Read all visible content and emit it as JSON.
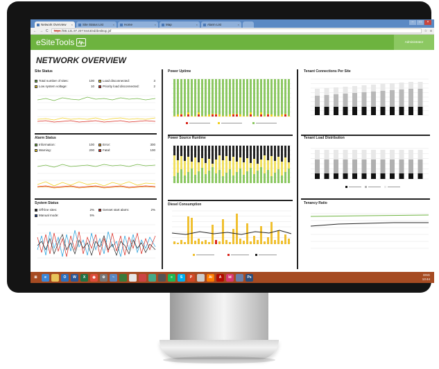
{
  "browser": {
    "tabs": [
      {
        "label": "Network Overview"
      },
      {
        "label": "Site Status List"
      },
      {
        "label": "Home"
      },
      {
        "label": "Map"
      },
      {
        "label": "Alarm List"
      }
    ],
    "url_scheme": "https",
    "url": "://88.131.97.207:8443/ed/desktop.jsf"
  },
  "app": {
    "logo": "eSiteTools",
    "user": "Administrator",
    "page_title": "NETWORK OVERVIEW"
  },
  "site_status": {
    "title": "Site Status",
    "stats": [
      {
        "label": "Total number of sites:",
        "value": "100",
        "color": "#6db33f"
      },
      {
        "label": "Load disconnected:",
        "value": "3",
        "color": "#f0d020"
      },
      {
        "label": "Low system voltage:",
        "value": "10",
        "color": "#f0d020"
      },
      {
        "label": "Priority load disconnected:",
        "value": "2",
        "color": "#d9261c"
      }
    ]
  },
  "alarm_status": {
    "title": "Alarm Status",
    "stats": [
      {
        "label": "Information:",
        "value": "100",
        "color": "#6db33f"
      },
      {
        "label": "Error:",
        "value": "300",
        "color": "#f0a020"
      },
      {
        "label": "Warning:",
        "value": "200",
        "color": "#f0d020"
      },
      {
        "label": "Fatal:",
        "value": "100",
        "color": "#d9261c"
      }
    ]
  },
  "system_status": {
    "title": "System Status",
    "stats": [
      {
        "label": "Off-line sites:",
        "value": "2%",
        "color": "#222222"
      },
      {
        "label": "Genset start alarm:",
        "value": "2%",
        "color": "#d9261c"
      },
      {
        "label": "Manual mode:",
        "value": "5%",
        "color": "#1a3e8c"
      }
    ]
  },
  "middle": {
    "power_uptime": "Power Uptime",
    "power_source_runtime": "Power Source Runtime",
    "diesel_consumption": "Diesel Consumption"
  },
  "right": {
    "tenant_connections": "Tenant Connections Per Site",
    "tenant_load": "Tenant Load Distribution",
    "tenancy_ratio": "Tenancy Ratio"
  },
  "colors": {
    "green": "#6db33f",
    "yellow": "#f0d020",
    "red": "#d9261c",
    "black": "#222222",
    "taskbar": "#a64b22"
  },
  "taskbar": {
    "clock_time": "13:44",
    "clock_lang": "ENG",
    "icons": [
      "start-icon",
      "ie-icon",
      "folder-icon",
      "outlook-icon",
      "word-icon",
      "excel-icon",
      "chrome-icon",
      "settings-icon",
      "pulse-icon",
      "app-icon",
      "notes-icon",
      "snip-icon",
      "paint-icon",
      "media-icon",
      "spotify-icon",
      "skype-icon",
      "powerpoint-icon",
      "mail-icon",
      "illustrator-icon",
      "acrobat-icon",
      "indesign-icon",
      "image-icon",
      "photoshop-icon"
    ]
  }
}
